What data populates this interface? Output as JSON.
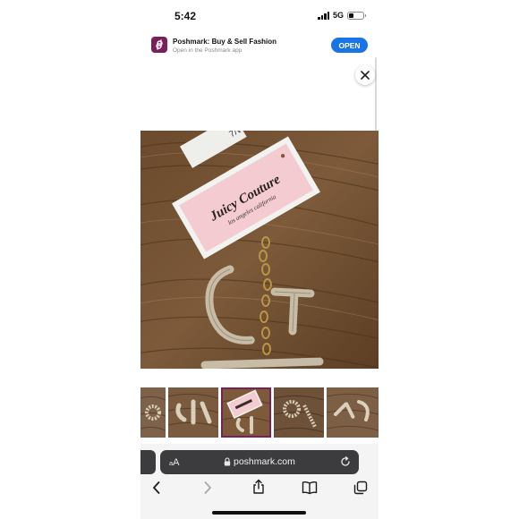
{
  "status_bar": {
    "time": "5:42",
    "network": "5G",
    "battery_fraction": 0.3
  },
  "smart_banner": {
    "app_name": "Poshmark: Buy & Sell Fashion",
    "subtitle": "Open in the Poshmark app",
    "open_label": "OPEN",
    "icon": "poshmark-logo-icon"
  },
  "product": {
    "image": "juicy-couture-rhinestone-letter-keychain-photo",
    "tag_brand": "Juicy Couture",
    "tag_tagline": "los angeles california",
    "thumbnails": [
      {
        "selected": false,
        "image": "letter-keychain-partial"
      },
      {
        "selected": false,
        "image": "rhinestone-letters-on-wood"
      },
      {
        "selected": true,
        "image": "juicy-couture-tag-with-letters"
      },
      {
        "selected": false,
        "image": "letters-on-wood-closeup"
      },
      {
        "selected": false,
        "image": "letters-cropped"
      }
    ]
  },
  "browser": {
    "text_size_label": "AA",
    "url": "poshmark.com",
    "icons": [
      "back-icon",
      "forward-icon",
      "share-icon",
      "bookmarks-icon",
      "tabs-icon",
      "reload-icon",
      "lock-icon"
    ]
  },
  "colors": {
    "accent": "#1a74e4",
    "poshmark": "#7a1f5a",
    "toolbar": "#3c3c3e"
  }
}
